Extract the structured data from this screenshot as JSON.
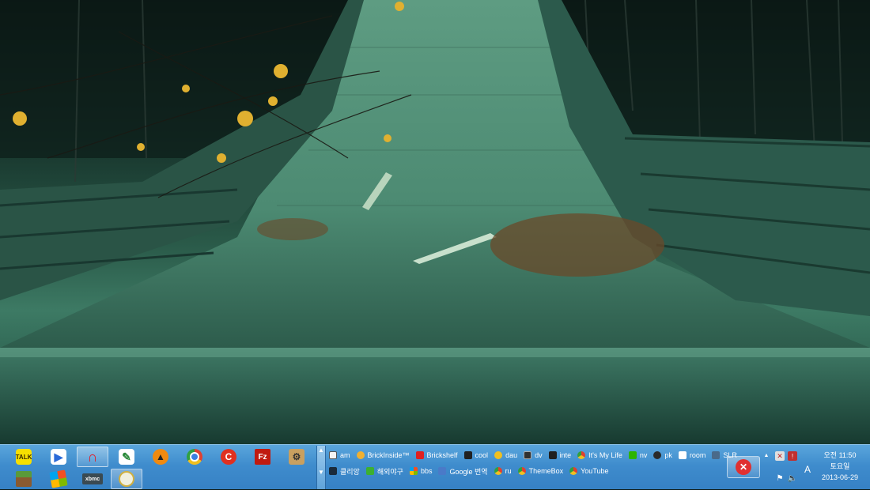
{
  "desktop": {
    "wallpaper": "wooden boardwalk bridge in a forest with autumn leaves"
  },
  "taskbar": {
    "pinned_apps": [
      {
        "name": "kakaotalk-icon",
        "label": "TALK"
      },
      {
        "name": "daum-potplayer-icon",
        "label": ""
      },
      {
        "name": "magnet-icon",
        "label": ""
      },
      {
        "name": "feather-app-icon",
        "label": ""
      },
      {
        "name": "aimp-icon",
        "label": ""
      },
      {
        "name": "chrome-icon",
        "label": ""
      },
      {
        "name": "ccleaner-icon",
        "label": "C"
      },
      {
        "name": "filezilla-icon",
        "label": "Fz"
      },
      {
        "name": "tool-app-icon",
        "label": ""
      },
      {
        "name": "minecraft-icon",
        "label": ""
      },
      {
        "name": "windows-icon",
        "label": ""
      },
      {
        "name": "xbmc-icon",
        "label": "xbmc"
      },
      {
        "name": "chat-bubble-icon",
        "label": ""
      }
    ],
    "links_row1": [
      {
        "name": "link-am",
        "icon": "amazon-icon",
        "label": "am",
        "color": "#f4f4f4"
      },
      {
        "name": "link-brickinside",
        "icon": "brickinside-icon",
        "label": "BrickInside™",
        "color": "#f0b030"
      },
      {
        "name": "link-brickshelf",
        "icon": "brickshelf-icon",
        "label": "Brickshelf",
        "color": "#e02020"
      },
      {
        "name": "link-cool",
        "icon": "cool-icon",
        "label": "cool",
        "color": "#202020"
      },
      {
        "name": "link-dau",
        "icon": "daum-icon",
        "label": "dau",
        "color": "#f0c020"
      },
      {
        "name": "link-dv",
        "icon": "dv-icon",
        "label": "dv",
        "color": "#303030"
      },
      {
        "name": "link-inte",
        "icon": "ifl-icon",
        "label": "inte",
        "color": "#202020"
      },
      {
        "name": "link-its-my-life",
        "icon": "chrome-icon",
        "label": "It's My Life",
        "color": "#e04030"
      },
      {
        "name": "link-nv",
        "icon": "naver-icon",
        "label": "nv",
        "color": "#2db400"
      },
      {
        "name": "link-pk",
        "icon": "pk-icon",
        "label": "pk",
        "color": "#2a2a2a"
      },
      {
        "name": "link-room",
        "icon": "room-icon",
        "label": "room",
        "color": "#ffffff"
      },
      {
        "name": "link-slr",
        "icon": "slr-icon",
        "label": "SLR",
        "color": "#4a6a8a"
      }
    ],
    "links_row2": [
      {
        "name": "link-clien",
        "icon": "clien-icon",
        "label": "클리앙",
        "color": "#1a2a3a"
      },
      {
        "name": "link-mlbpark",
        "icon": "baseball-icon",
        "label": "해외야구",
        "color": "#3cb030"
      },
      {
        "name": "link-bbs",
        "icon": "windows-icon",
        "label": "bbs",
        "color": "#f25022"
      },
      {
        "name": "link-google-translate",
        "icon": "translate-icon",
        "label": "Google 번역",
        "color": "#4a7ac8"
      },
      {
        "name": "link-ru",
        "icon": "chrome-icon",
        "label": "ru",
        "color": "#e04030"
      },
      {
        "name": "link-themebox",
        "icon": "chrome-icon",
        "label": "ThemeBox",
        "color": "#e04030"
      },
      {
        "name": "link-youtube",
        "icon": "chrome-icon",
        "label": "YouTube",
        "color": "#e04030"
      }
    ],
    "tray": {
      "ime": "A"
    },
    "clock": {
      "time": "오전 11:50",
      "weekday": "토요일",
      "date": "2013-06-29"
    }
  }
}
